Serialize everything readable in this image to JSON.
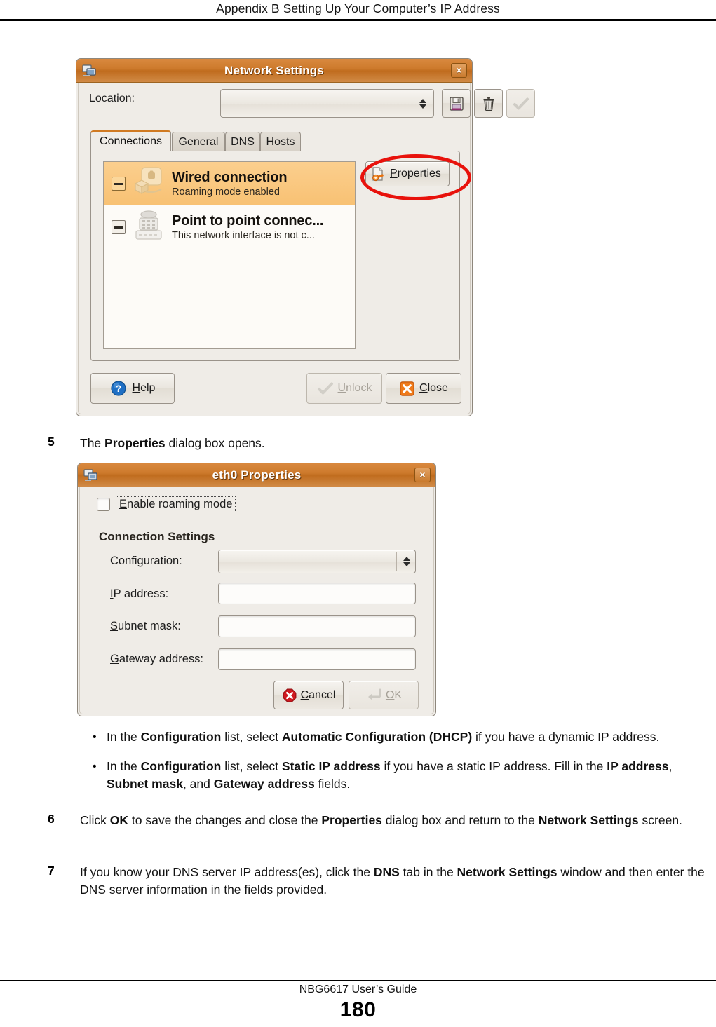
{
  "page": {
    "running_head": "Appendix B Setting Up Your Computer’s IP Address",
    "footer_title": "NBG6617 User’s Guide",
    "footer_page": "180"
  },
  "colors": {
    "titlebar_orange": "#cd7a2c",
    "annotation_red": "#e8120c",
    "selection_orange": "#f8c173",
    "dialog_bg": "#efece7"
  },
  "network_settings_dialog": {
    "title": "Network Settings",
    "window_icon": "network-icon",
    "close_button": "×",
    "location": {
      "label": "Location:",
      "value": "",
      "placeholder": ""
    },
    "toolbar": [
      {
        "name": "save-location-button",
        "icon": "floppy-disk-icon"
      },
      {
        "name": "delete-location-button",
        "icon": "trash-icon"
      },
      {
        "name": "apply-location-button",
        "icon": "checkmark-icon",
        "disabled": true
      }
    ],
    "tabs": [
      {
        "label": "Connections",
        "active": true
      },
      {
        "label": "General",
        "active": false
      },
      {
        "label": "DNS",
        "active": false
      },
      {
        "label": "Hosts",
        "active": false
      }
    ],
    "connections": [
      {
        "name": "Wired connection",
        "status": "Roaming mode enabled",
        "icon": "wired-connection-icon",
        "selected": true
      },
      {
        "name": "Point to point connec...",
        "status": "This network interface is not c...",
        "icon": "modem-icon",
        "selected": false
      }
    ],
    "properties_button": {
      "label": "Properties",
      "icon": "properties-icon",
      "annotated": true
    },
    "buttons": [
      {
        "label": "Help",
        "icon": "help-icon",
        "disabled": false
      },
      {
        "label": "Unlock",
        "icon": "unlock-checkmark-icon",
        "disabled": true
      },
      {
        "label": "Close",
        "icon": "close-x-icon",
        "disabled": false
      }
    ]
  },
  "eth0_properties_dialog": {
    "title": "eth0 Properties",
    "window_icon": "network-icon",
    "close_button": "×",
    "roaming_checkbox": {
      "label": "Enable roaming mode",
      "checked": false
    },
    "group_title": "Connection Settings",
    "fields": [
      {
        "label": "Configuration:",
        "type": "combo",
        "value": ""
      },
      {
        "label": "IP address:",
        "type": "entry",
        "value": ""
      },
      {
        "label": "Subnet mask:",
        "type": "entry",
        "value": ""
      },
      {
        "label": "Gateway address:",
        "type": "entry",
        "value": ""
      }
    ],
    "buttons": [
      {
        "label": "Cancel",
        "icon": "cancel-icon",
        "disabled": false
      },
      {
        "label": "OK",
        "icon": "enter-arrow-icon",
        "disabled": true
      }
    ]
  },
  "steps": {
    "step5": {
      "number": "5",
      "text_html": "The <b>Properties</b> dialog box opens."
    },
    "bullets": [
      "In the <b>Configuration</b> list, select <b>Automatic Configuration (DHCP)</b> if you have a dynamic IP address.",
      "In the <b>Configuration</b> list, select <b>Static IP address</b> if you have a static IP address. Fill in the <b>IP address</b>, <b>Subnet mask</b>, and <b>Gateway address</b> fields."
    ],
    "step6": {
      "number": "6",
      "text_html": "Click <b>OK</b> to save the changes and close the <b>Properties</b> dialog box and return to the <b>Network Settings</b> screen."
    },
    "step7": {
      "number": "7",
      "text_html": "If you know your DNS server IP address(es), click the <b>DNS</b> tab in the <b>Network Settings</b> window and then enter the DNS server information in the fields provided."
    }
  }
}
